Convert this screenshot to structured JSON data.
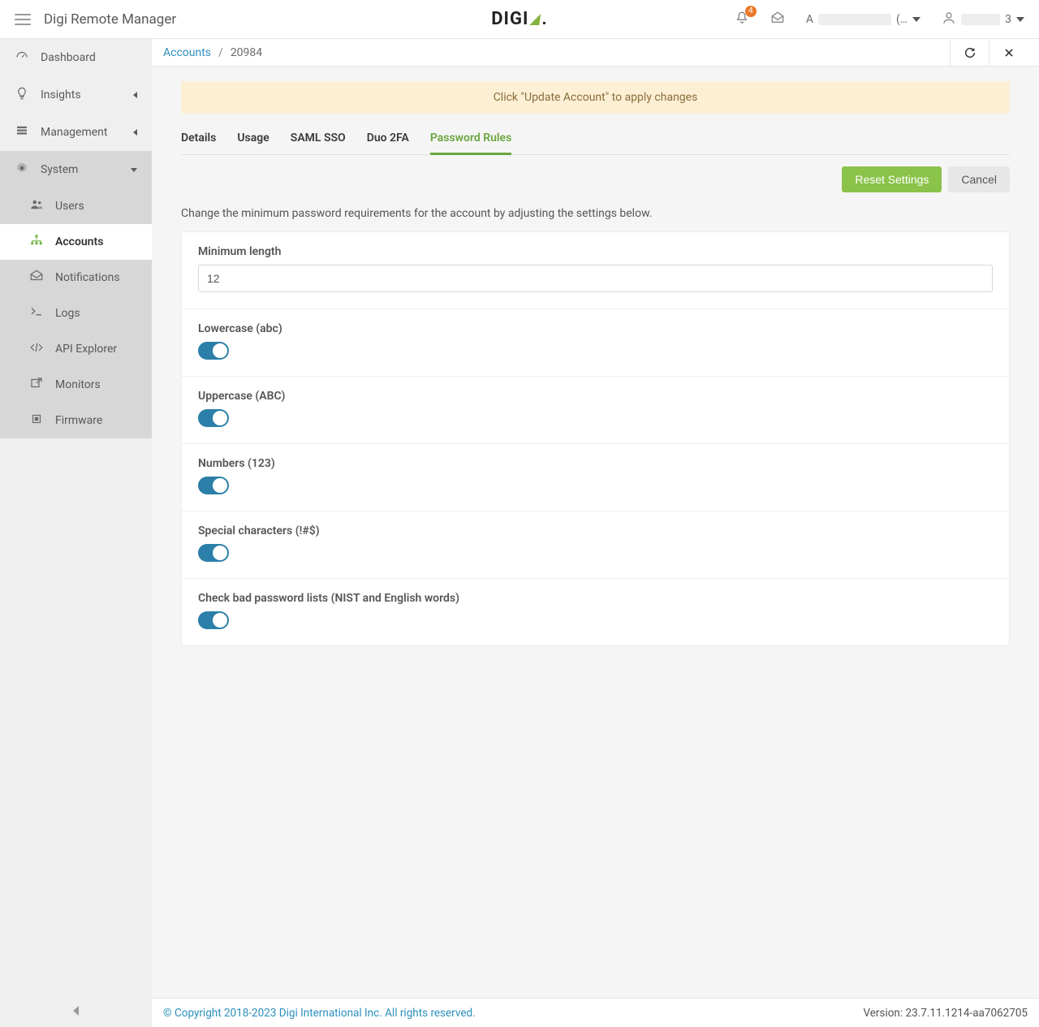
{
  "header": {
    "app_title": "Digi Remote Manager",
    "logo_text": "DIGI",
    "bell_badge": "4",
    "account_prefix": "A",
    "account_suffix": "(…",
    "user_suffix": "3"
  },
  "sidebar": {
    "items": [
      {
        "label": "Dashboard",
        "icon": "gauge",
        "expandable": false
      },
      {
        "label": "Insights",
        "icon": "bulb",
        "expandable": true
      },
      {
        "label": "Management",
        "icon": "stack",
        "expandable": true
      },
      {
        "label": "System",
        "icon": "gear",
        "expandable": true,
        "expanded": true
      }
    ],
    "system_children": [
      {
        "label": "Users",
        "icon": "users"
      },
      {
        "label": "Accounts",
        "icon": "sitemap",
        "active": true
      },
      {
        "label": "Notifications",
        "icon": "envelope"
      },
      {
        "label": "Logs",
        "icon": "terminal"
      },
      {
        "label": "API Explorer",
        "icon": "code"
      },
      {
        "label": "Monitors",
        "icon": "external"
      },
      {
        "label": "Firmware",
        "icon": "chip"
      }
    ]
  },
  "breadcrumb": {
    "root": "Accounts",
    "current": "20984"
  },
  "alert": "Click \"Update Account\" to apply changes",
  "tabs": [
    {
      "label": "Details"
    },
    {
      "label": "Usage"
    },
    {
      "label": "SAML SSO"
    },
    {
      "label": "Duo 2FA"
    },
    {
      "label": "Password Rules",
      "active": true
    }
  ],
  "buttons": {
    "reset": "Reset Settings",
    "cancel": "Cancel"
  },
  "instructions": "Change the minimum password requirements for the account by adjusting the settings below.",
  "settings": {
    "min_length": {
      "label": "Minimum length",
      "value": "12"
    },
    "lowercase": {
      "label": "Lowercase (abc)",
      "on": true
    },
    "uppercase": {
      "label": "Uppercase (ABC)",
      "on": true
    },
    "numbers": {
      "label": "Numbers (123)",
      "on": true
    },
    "special": {
      "label": "Special characters (!#$)",
      "on": true
    },
    "badlist": {
      "label": "Check bad password lists (NIST and English words)",
      "on": true
    }
  },
  "footer": {
    "copyright": "© Copyright 2018-2023 Digi International Inc. All rights reserved.",
    "version": "Version: 23.7.11.1214-aa7062705"
  }
}
